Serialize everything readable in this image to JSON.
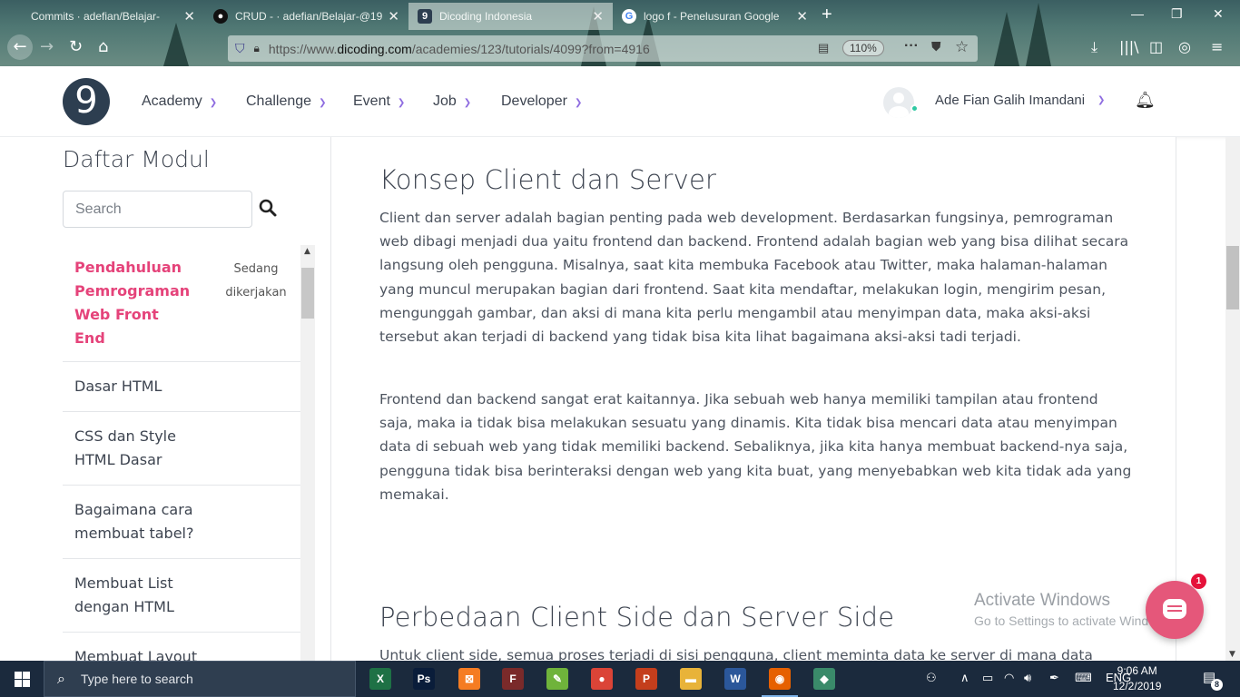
{
  "browser": {
    "tabs": [
      {
        "title": "Commits · adefian/Belajar-",
        "icon": "square-icon",
        "active": false
      },
      {
        "title": "CRUD - · adefian/Belajar-@19f",
        "icon": "github-icon",
        "active": false
      },
      {
        "title": "Dicoding Indonesia",
        "icon": "dicoding-icon",
        "active": true
      },
      {
        "title": "logo f - Penelusuran Google",
        "icon": "google-icon",
        "active": false
      }
    ],
    "new_tab": "+",
    "url_prefix": "https://www.",
    "url_domain": "dicoding.com",
    "url_path": "/academies/123/tutorials/4099?from=4916",
    "zoom": "110%"
  },
  "site": {
    "logo_text": "9",
    "menu": [
      "Academy",
      "Challenge",
      "Event",
      "Job",
      "Developer"
    ],
    "user_name": "Ade Fian Galih Imandani"
  },
  "sidebar": {
    "title": "Daftar Modul",
    "search_placeholder": "Search",
    "modules": [
      {
        "label": "Pendahuluan Pemrograman Web Front End",
        "state": "Sedang dikerjakan",
        "current": true
      },
      {
        "label": "Dasar HTML",
        "state": "",
        "current": false
      },
      {
        "label": "CSS dan Style HTML Dasar",
        "state": "",
        "current": false
      },
      {
        "label": "Bagaimana cara membuat tabel?",
        "state": "",
        "current": false
      },
      {
        "label": "Membuat List dengan HTML",
        "state": "",
        "current": false
      },
      {
        "label": "Membuat Layout dengan tag",
        "state": "",
        "current": false
      }
    ]
  },
  "article": {
    "heading1": "Konsep Client dan Server",
    "para1": "Client dan server adalah bagian penting pada web development. Berdasarkan fungsinya, pemrograman web dibagi menjadi dua yaitu frontend dan backend. Frontend adalah bagian web yang bisa dilihat secara langsung oleh pengguna. Misalnya, saat kita membuka Facebook atau Twitter, maka halaman-halaman yang muncul merupakan bagian dari frontend. Saat kita mendaftar, melakukan login, mengirim pesan, mengunggah gambar, dan aksi di mana kita perlu mengambil atau menyimpan data, maka aksi-aksi tersebut akan terjadi di backend yang tidak bisa kita lihat bagaimana aksi-aksi tadi terjadi.",
    "para2": "Frontend dan backend sangat erat kaitannya. Jika sebuah web hanya memiliki tampilan atau frontend saja, maka ia tidak bisa melakukan sesuatu yang dinamis. Kita tidak bisa mencari data atau menyimpan data di sebuah web yang tidak memiliki backend. Sebaliknya, jika kita hanya membuat backend-nya saja, pengguna tidak bisa berinteraksi dengan web yang kita buat, yang menyebabkan web kita tidak ada yang memakai.",
    "heading2": "Perbedaan Client Side dan Server Side",
    "para3": "Untuk client side, semua proses terjadi di sisi pengguna, client meminta data ke server di mana data"
  },
  "overlay": {
    "watermark_title": "Activate Windows",
    "watermark_sub": "Go to Settings to activate Windows.",
    "chat_badge": "1"
  },
  "taskbar": {
    "search_text": "Type here to search",
    "apps": [
      {
        "name": "excel-icon",
        "glyph": "X",
        "color": "#1e7145"
      },
      {
        "name": "photoshop-icon",
        "glyph": "Ps",
        "color": "#0a1d3a"
      },
      {
        "name": "xampp-icon",
        "glyph": "⊠",
        "color": "#f57c22"
      },
      {
        "name": "flash-icon",
        "glyph": "F",
        "color": "#7a2a2a"
      },
      {
        "name": "notepad-plus-icon",
        "glyph": "✎",
        "color": "#6fb33b"
      },
      {
        "name": "chrome-icon",
        "glyph": "●",
        "color": "#db4437"
      },
      {
        "name": "powerpoint-icon",
        "glyph": "P",
        "color": "#c43e1c"
      },
      {
        "name": "file-explorer-icon",
        "glyph": "▬",
        "color": "#e8b339"
      },
      {
        "name": "word-icon",
        "glyph": "W",
        "color": "#2b579a"
      },
      {
        "name": "firefox-icon",
        "glyph": "◉",
        "color": "#e66000"
      },
      {
        "name": "git-icon",
        "glyph": "◆",
        "color": "#3a8a6a"
      }
    ],
    "lang": "ENG",
    "time": "9:06 AM",
    "date": "12/2/2019",
    "notif_count": "8"
  }
}
